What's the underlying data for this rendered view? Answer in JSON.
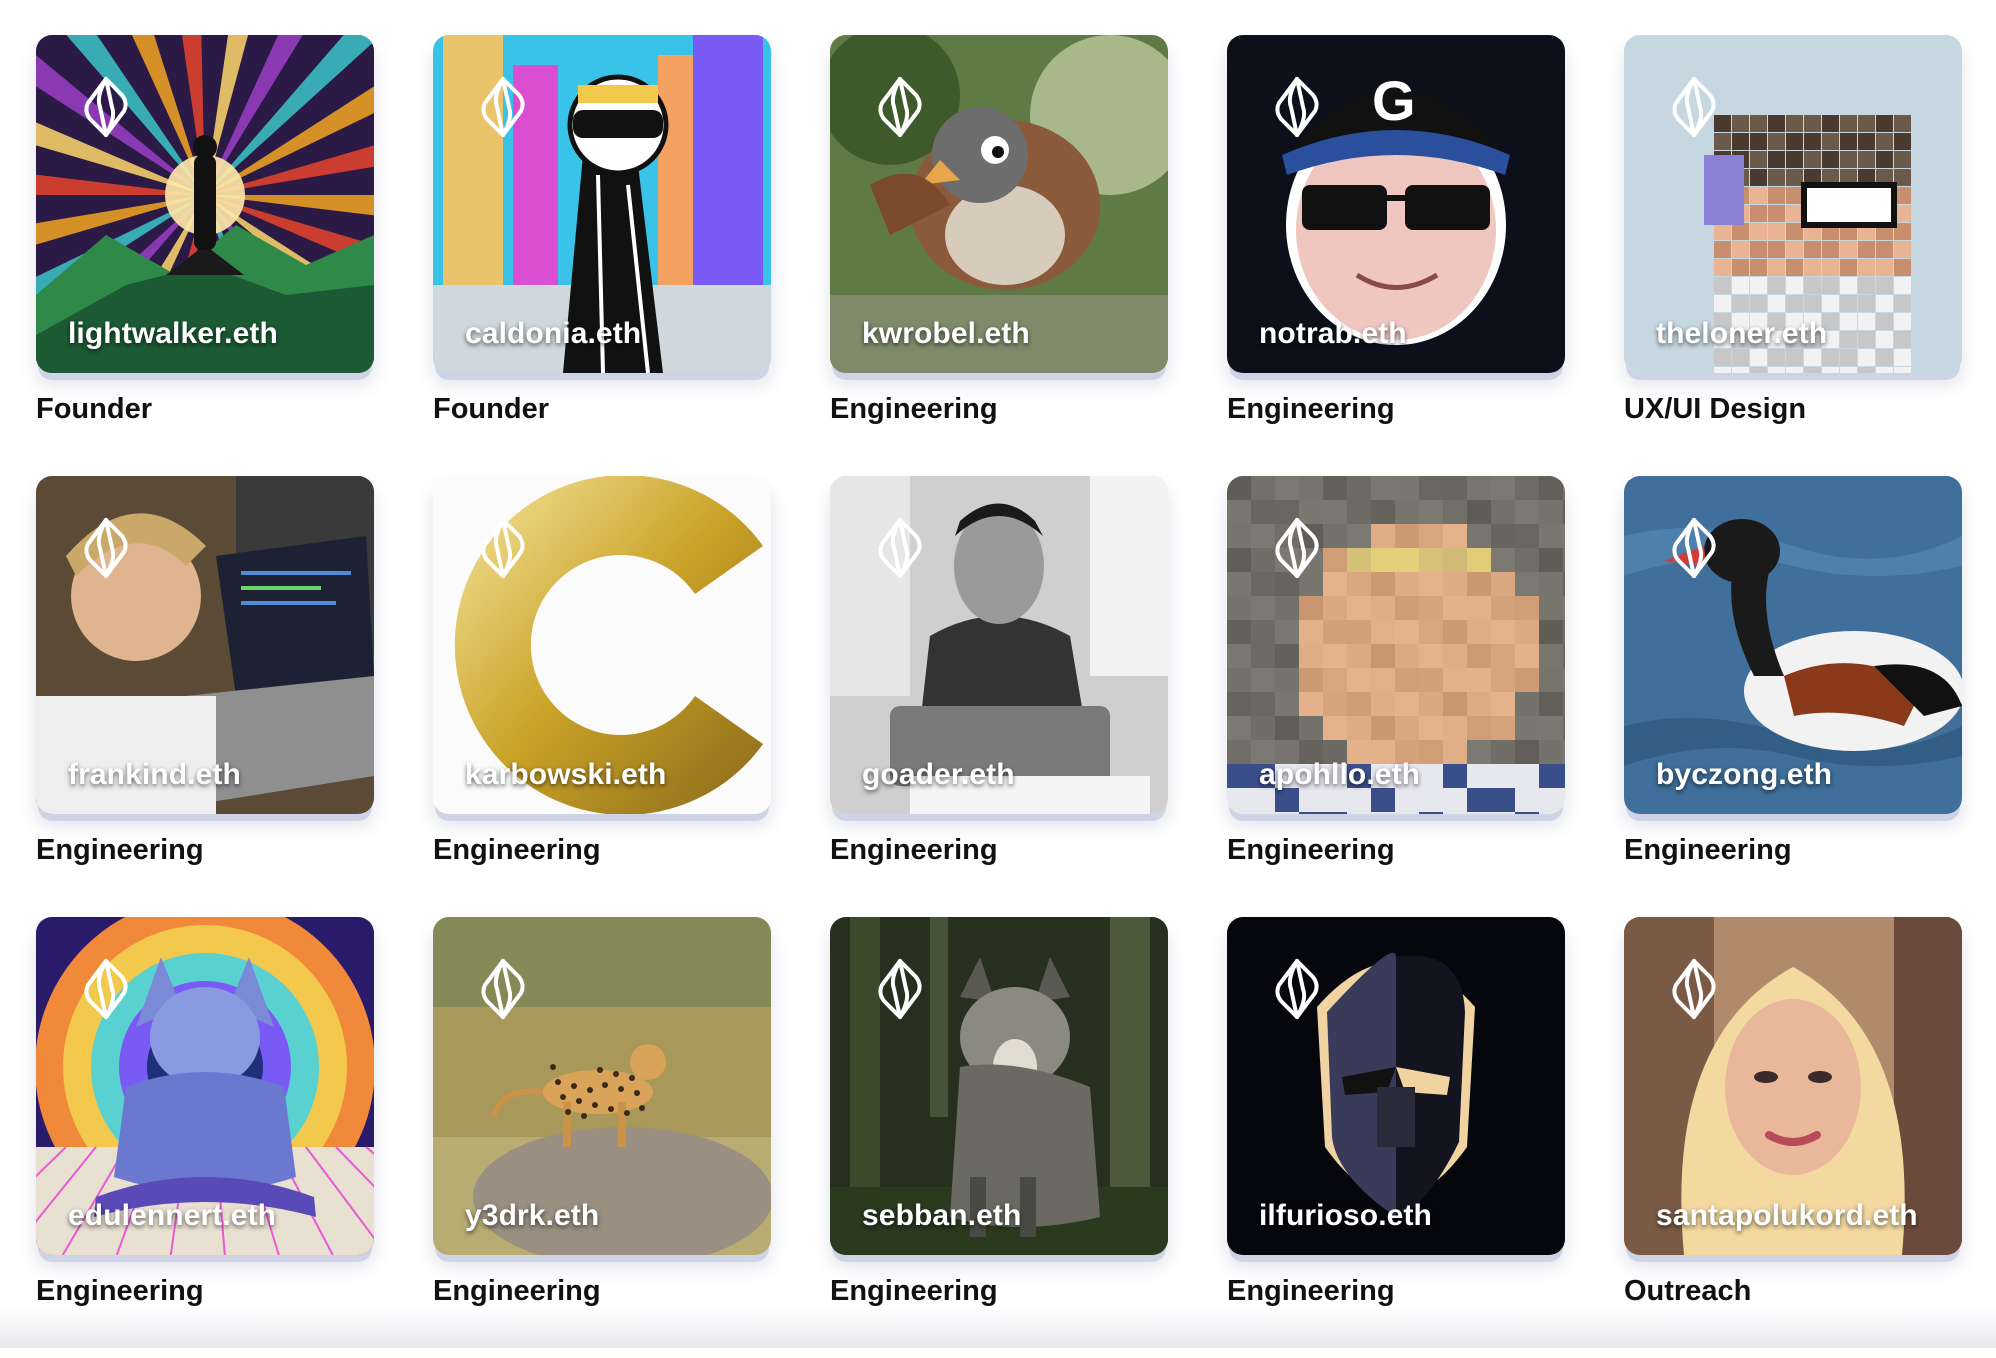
{
  "members": [
    {
      "name": "lightwalker.eth",
      "role": "Founder",
      "art": "mountain-rays",
      "colors": {
        "bg": "#2b1a45",
        "accent": "#f5a623"
      }
    },
    {
      "name": "caldonia.eth",
      "role": "Founder",
      "art": "helmet-city",
      "colors": {
        "bg": "#3ac3e8",
        "accent": "#d94fd0"
      }
    },
    {
      "name": "kwrobel.eth",
      "role": "Engineering",
      "art": "cartoon-bird",
      "colors": {
        "bg": "#5f7a45",
        "accent": "#8a5a3a"
      }
    },
    {
      "name": "notrab.eth",
      "role": "Engineering",
      "art": "cap-sunglasses",
      "colors": {
        "bg": "#0d0f1a",
        "accent": "#2a4f9c"
      }
    },
    {
      "name": "theloner.eth",
      "role": "UX/UI Design",
      "art": "pixel-ape",
      "colors": {
        "bg": "#c6d7e2",
        "accent": "#8b7fd6"
      }
    },
    {
      "name": "frankind.eth",
      "role": "Engineering",
      "art": "laptop-photo",
      "colors": {
        "bg": "#8a7a5c",
        "accent": "#c9a86a"
      }
    },
    {
      "name": "karbowski.eth",
      "role": "Engineering",
      "art": "gold-c",
      "colors": {
        "bg": "#fbfbfb",
        "accent": "#d4af37"
      }
    },
    {
      "name": "goader.eth",
      "role": "Engineering",
      "art": "typewriter-bw",
      "colors": {
        "bg": "#9a9a9a",
        "accent": "#222222"
      }
    },
    {
      "name": "apohllo.eth",
      "role": "Engineering",
      "art": "pixel-portrait",
      "colors": {
        "bg": "#6f6a5f",
        "accent": "#d9a77a"
      }
    },
    {
      "name": "byczong.eth",
      "role": "Engineering",
      "art": "duck-water",
      "colors": {
        "bg": "#3f6f9a",
        "accent": "#f2f2f2"
      }
    },
    {
      "name": "edulennert.eth",
      "role": "Engineering",
      "art": "meditating-wolf",
      "colors": {
        "bg": "#1f2f7a",
        "accent": "#f08a3a"
      }
    },
    {
      "name": "y3drk.eth",
      "role": "Engineering",
      "art": "cheetah-savanna",
      "colors": {
        "bg": "#a89a5a",
        "accent": "#c98a3a"
      }
    },
    {
      "name": "sebban.eth",
      "role": "Engineering",
      "art": "wolf-forest",
      "colors": {
        "bg": "#27301f",
        "accent": "#8a8a80"
      }
    },
    {
      "name": "ilfurioso.eth",
      "role": "Engineering",
      "art": "mask-face",
      "colors": {
        "bg": "#06070d",
        "accent": "#f0d3a0"
      }
    },
    {
      "name": "santapolukord.eth",
      "role": "Outreach",
      "art": "blonde-portrait",
      "colors": {
        "bg": "#b08a6a",
        "accent": "#f3d9a0"
      }
    }
  ]
}
